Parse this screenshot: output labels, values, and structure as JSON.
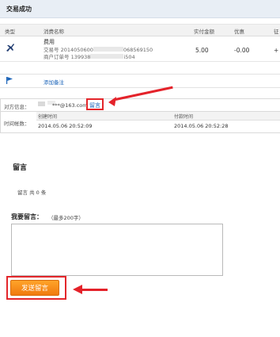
{
  "header": {
    "title": "交易成功"
  },
  "table": {
    "columns": [
      "类型",
      "消费名称",
      "实付金额",
      "优惠",
      "征"
    ],
    "row": {
      "name": "费用",
      "trade_no_label": "交易号",
      "trade_no_prefix": "2014050600",
      "trade_no_suffix": "068569150",
      "merchant_no_label": "商户订单号",
      "merchant_no_prefix": "139938",
      "merchant_no_suffix": "i504",
      "amount": "5.00",
      "discount": "-0.00",
      "extra": "+"
    }
  },
  "memo": {
    "add_label": "添加备注"
  },
  "counterparty": {
    "label": "对方信息：",
    "email": "***@163.com",
    "message_link": "留言"
  },
  "time": {
    "label": "时间帐数：",
    "created_header": "创建时间",
    "created_value": "2014.05.06 20:52:09",
    "paid_header": "付款时间",
    "paid_value": "2014.05.06 20:52:28"
  },
  "comments": {
    "title": "留言",
    "count_text": "留言 共 0 条",
    "my_label": "我要留言：",
    "limit_hint": "（最多200字）",
    "send_label": "发送留言"
  },
  "colors": {
    "accent_red": "#e3262b",
    "button_orange": "#f07a0e",
    "link_blue": "#1a63b8"
  }
}
